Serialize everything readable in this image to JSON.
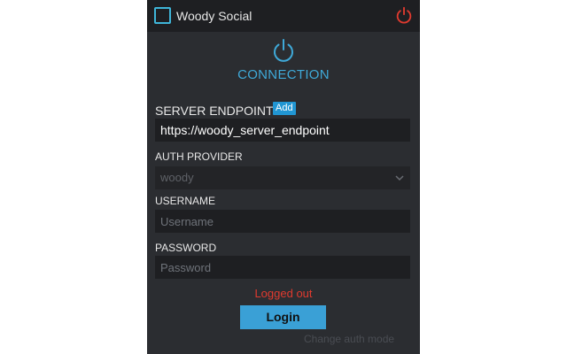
{
  "app": {
    "title": "Woody Social"
  },
  "connection": {
    "label": "CONNECTION"
  },
  "server": {
    "label": "SERVER ENDPOINT",
    "add_label": "Add",
    "value": "https://woody_server_endpoint"
  },
  "auth": {
    "label": "AUTH PROVIDER",
    "selected": "woody"
  },
  "username": {
    "label": "USERNAME",
    "placeholder": "Username"
  },
  "password": {
    "label": "PASSWORD",
    "placeholder": "Password"
  },
  "status": {
    "text": "Logged out"
  },
  "actions": {
    "login_label": "Login",
    "change_auth_label": "Change auth mode"
  },
  "colors": {
    "accent": "#3fa9d8",
    "button": "#3aa0d6",
    "error": "#e03a2f",
    "panel": "#2b2d31"
  }
}
